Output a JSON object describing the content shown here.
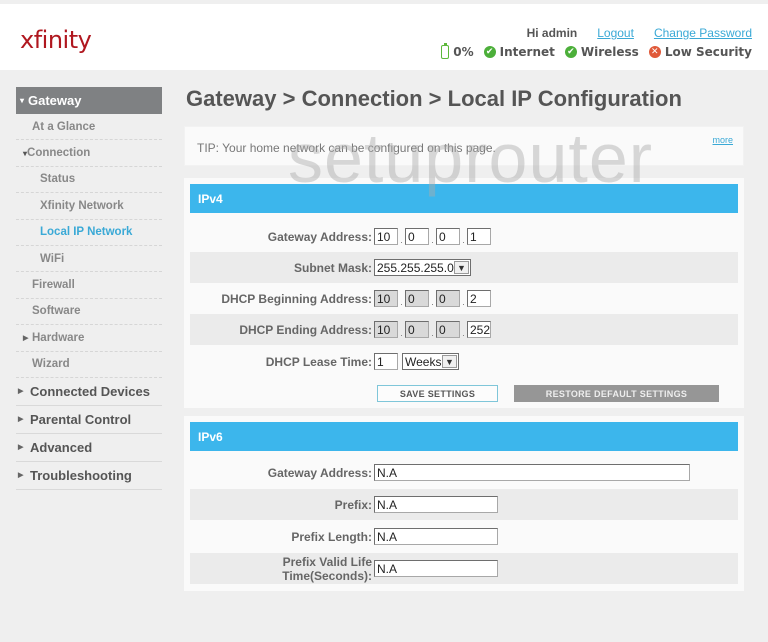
{
  "header": {
    "logo": "xfinity",
    "greeting": "Hi admin",
    "logout_label": "Logout",
    "change_password_label": "Change Password",
    "status": {
      "battery": "0%",
      "internet": "Internet",
      "wireless": "Wireless",
      "security": "Low Security"
    }
  },
  "sidebar": {
    "gateway": "Gateway",
    "items": [
      {
        "label": "At a Glance"
      },
      {
        "label": "Connection"
      },
      {
        "label": "Status"
      },
      {
        "label": "Xfinity Network"
      },
      {
        "label": "Local IP Network"
      },
      {
        "label": "WiFi"
      },
      {
        "label": "Firewall"
      },
      {
        "label": "Software"
      },
      {
        "label": "Hardware"
      },
      {
        "label": "Wizard"
      }
    ],
    "top_items": [
      {
        "label": "Connected Devices"
      },
      {
        "label": "Parental Control"
      },
      {
        "label": "Advanced"
      },
      {
        "label": "Troubleshooting"
      }
    ]
  },
  "main": {
    "title": "Gateway > Connection > Local IP Configuration",
    "tip": "TIP: Your home network can be configured on this page.",
    "more_label": "more",
    "watermark": "setuprouter",
    "ipv4": {
      "heading": "IPv4",
      "gateway_label": "Gateway Address:",
      "gateway": [
        "10",
        "0",
        "0",
        "1"
      ],
      "subnet_label": "Subnet Mask:",
      "subnet": "255.255.255.0",
      "dhcp_begin_label": "DHCP Beginning Address:",
      "dhcp_begin": [
        "10",
        "0",
        "0",
        "2"
      ],
      "dhcp_end_label": "DHCP Ending Address:",
      "dhcp_end": [
        "10",
        "0",
        "0",
        "252"
      ],
      "lease_label": "DHCP Lease Time:",
      "lease_value": "1",
      "lease_unit": "Weeks",
      "save_label": "SAVE SETTINGS",
      "restore_label": "RESTORE DEFAULT SETTINGS"
    },
    "ipv6": {
      "heading": "IPv6",
      "gateway_label": "Gateway Address:",
      "gateway": "N.A",
      "prefix_label": "Prefix:",
      "prefix": "N.A",
      "prefix_length_label": "Prefix Length:",
      "prefix_length": "N.A",
      "lifetime_label": "Prefix Valid Life Time(Seconds):",
      "lifetime": "N.A"
    }
  }
}
